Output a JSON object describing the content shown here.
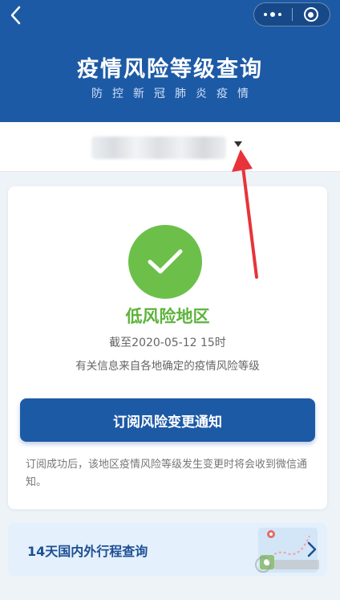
{
  "header": {
    "title": "疫情风险等级查询",
    "subtitle": "防控新冠肺炎疫情",
    "back_icon": "chevron-left-icon",
    "more_icon": "more-dots-icon",
    "close_icon": "target-close-icon",
    "bg_color": "#1d5aa6"
  },
  "region": {
    "value": "",
    "dropdown_icon": "triangle-down-icon"
  },
  "result": {
    "status_icon": "check-icon",
    "status_color": "#6cc04a",
    "risk_level": "低风险地区",
    "as_of": "截至2020-05-12 15时",
    "source_note": "有关信息来自各地确定的疫情风险等级"
  },
  "subscribe": {
    "button_label": "订阅风险变更通知",
    "note": "订阅成功后，该地区疫情风险等级发生变更时将会收到微信通知。"
  },
  "travel": {
    "label": "14天国内外行程查询",
    "chevron_icon": "chevron-right-icon"
  },
  "annotation": {
    "arrow_color": "#e8333a"
  }
}
